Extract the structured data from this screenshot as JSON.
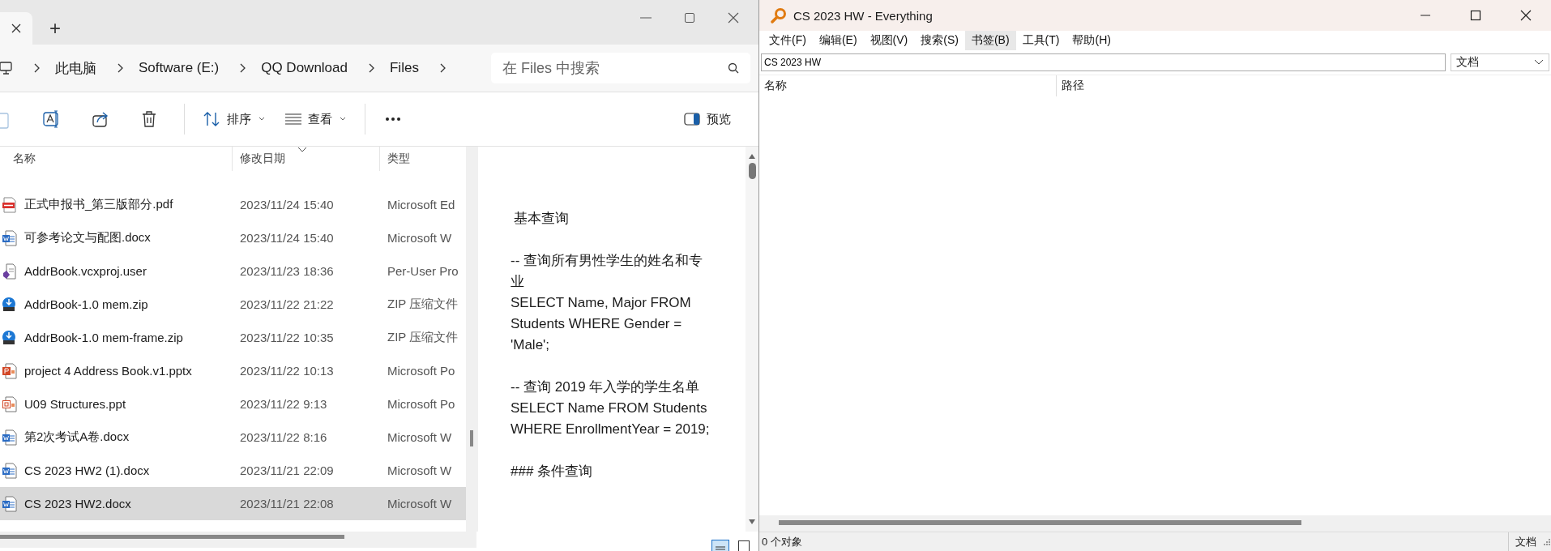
{
  "explorer": {
    "tab_add": "+",
    "breadcrumb": [
      "此电脑",
      "Software (E:)",
      "QQ Download",
      "Files"
    ],
    "search": {
      "placeholder": "在 Files 中搜索"
    },
    "toolbar": {
      "sort": "排序",
      "view": "查看",
      "preview": "预览"
    },
    "columns": [
      {
        "label": "名称",
        "sorted": false
      },
      {
        "label": "修改日期",
        "sorted": true
      },
      {
        "label": "类型",
        "sorted": false
      }
    ],
    "rows": [
      {
        "name": "正式申报书_第三版部分.pdf",
        "date": "2023/11/24 15:40",
        "type": "Microsoft Ed",
        "kind": "pdf",
        "selected": false
      },
      {
        "name": "可参考论文与配图.docx",
        "date": "2023/11/24 15:40",
        "type": "Microsoft W",
        "kind": "word",
        "selected": false
      },
      {
        "name": "AddrBook.vcxproj.user",
        "date": "2023/11/23 18:36",
        "type": "Per-User Pro",
        "kind": "project",
        "selected": false
      },
      {
        "name": "AddrBook-1.0 mem.zip",
        "date": "2023/11/22 21:22",
        "type": "ZIP 压缩文件",
        "kind": "zip",
        "selected": false
      },
      {
        "name": "AddrBook-1.0 mem-frame.zip",
        "date": "2023/11/22 10:35",
        "type": "ZIP 压缩文件",
        "kind": "zip",
        "selected": false
      },
      {
        "name": "project 4 Address Book.v1.pptx",
        "date": "2023/11/22 10:13",
        "type": "Microsoft Po",
        "kind": "pptx",
        "selected": false
      },
      {
        "name": "U09 Structures.ppt",
        "date": "2023/11/22 9:13",
        "type": "Microsoft Po",
        "kind": "ppt",
        "selected": false
      },
      {
        "name": "第2次考试A卷.docx",
        "date": "2023/11/22 8:16",
        "type": "Microsoft W",
        "kind": "word",
        "selected": false
      },
      {
        "name": "CS 2023 HW2 (1).docx",
        "date": "2023/11/21 22:09",
        "type": "Microsoft W",
        "kind": "word",
        "selected": false
      },
      {
        "name": "CS 2023 HW2.docx",
        "date": "2023/11/21 22:08",
        "type": "Microsoft W",
        "kind": "word",
        "selected": true
      }
    ],
    "preview": [
      [
        "基本查询"
      ],
      [
        "-- 查询所有男性学生的姓名和专业",
        "SELECT Name, Major FROM Students WHERE Gender = 'Male';"
      ],
      [
        "-- 查询 2019 年入学的学生名单",
        "SELECT Name FROM Students WHERE EnrollmentYear = 2019;"
      ],
      [
        "### 条件查询"
      ]
    ]
  },
  "everything": {
    "window": {
      "title": "CS 2023 HW - Everything"
    },
    "menu": [
      {
        "label": "文件(F)",
        "selected": false
      },
      {
        "label": "编辑(E)",
        "selected": false
      },
      {
        "label": "视图(V)",
        "selected": false
      },
      {
        "label": "搜索(S)",
        "selected": false
      },
      {
        "label": "书签(B)",
        "selected": true
      },
      {
        "label": "工具(T)",
        "selected": false
      },
      {
        "label": "帮助(H)",
        "selected": false
      }
    ],
    "search": {
      "value": "CS 2023 HW"
    },
    "filter": "文档",
    "columns": [
      "名称",
      "路径"
    ],
    "status_bar": {
      "count": "0 个对象",
      "filter": "文档"
    }
  }
}
